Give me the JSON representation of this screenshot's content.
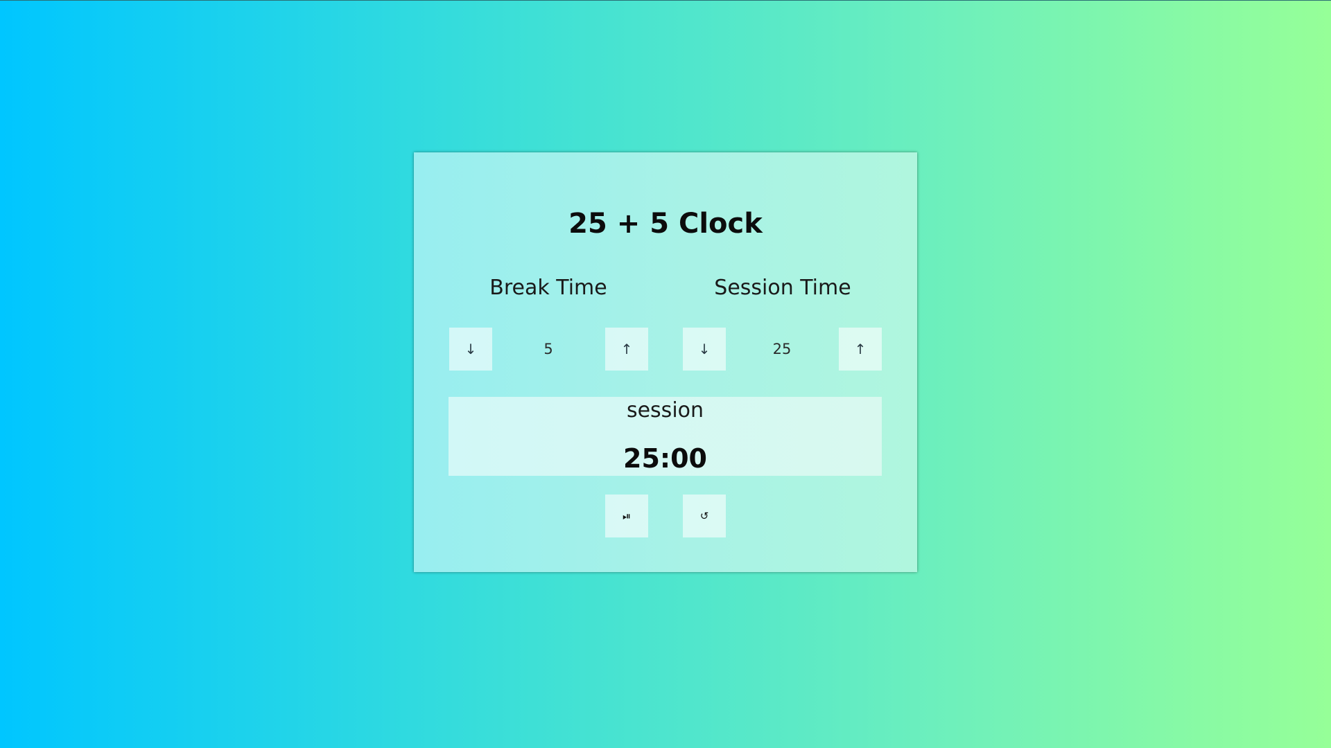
{
  "app": {
    "title": "25 + 5 Clock"
  },
  "break": {
    "label": "Break Time",
    "value": "5",
    "decrement_icon": "↓",
    "increment_icon": "↑"
  },
  "session": {
    "label": "Session Time",
    "value": "25",
    "decrement_icon": "↓",
    "increment_icon": "↑"
  },
  "timer": {
    "label": "session",
    "time": "25:00"
  },
  "controls": {
    "play_pause_icon": "⏯",
    "reset_icon": "↺"
  },
  "colors": {
    "background_start": "#00c6ff",
    "background_end": "#96ff98"
  }
}
